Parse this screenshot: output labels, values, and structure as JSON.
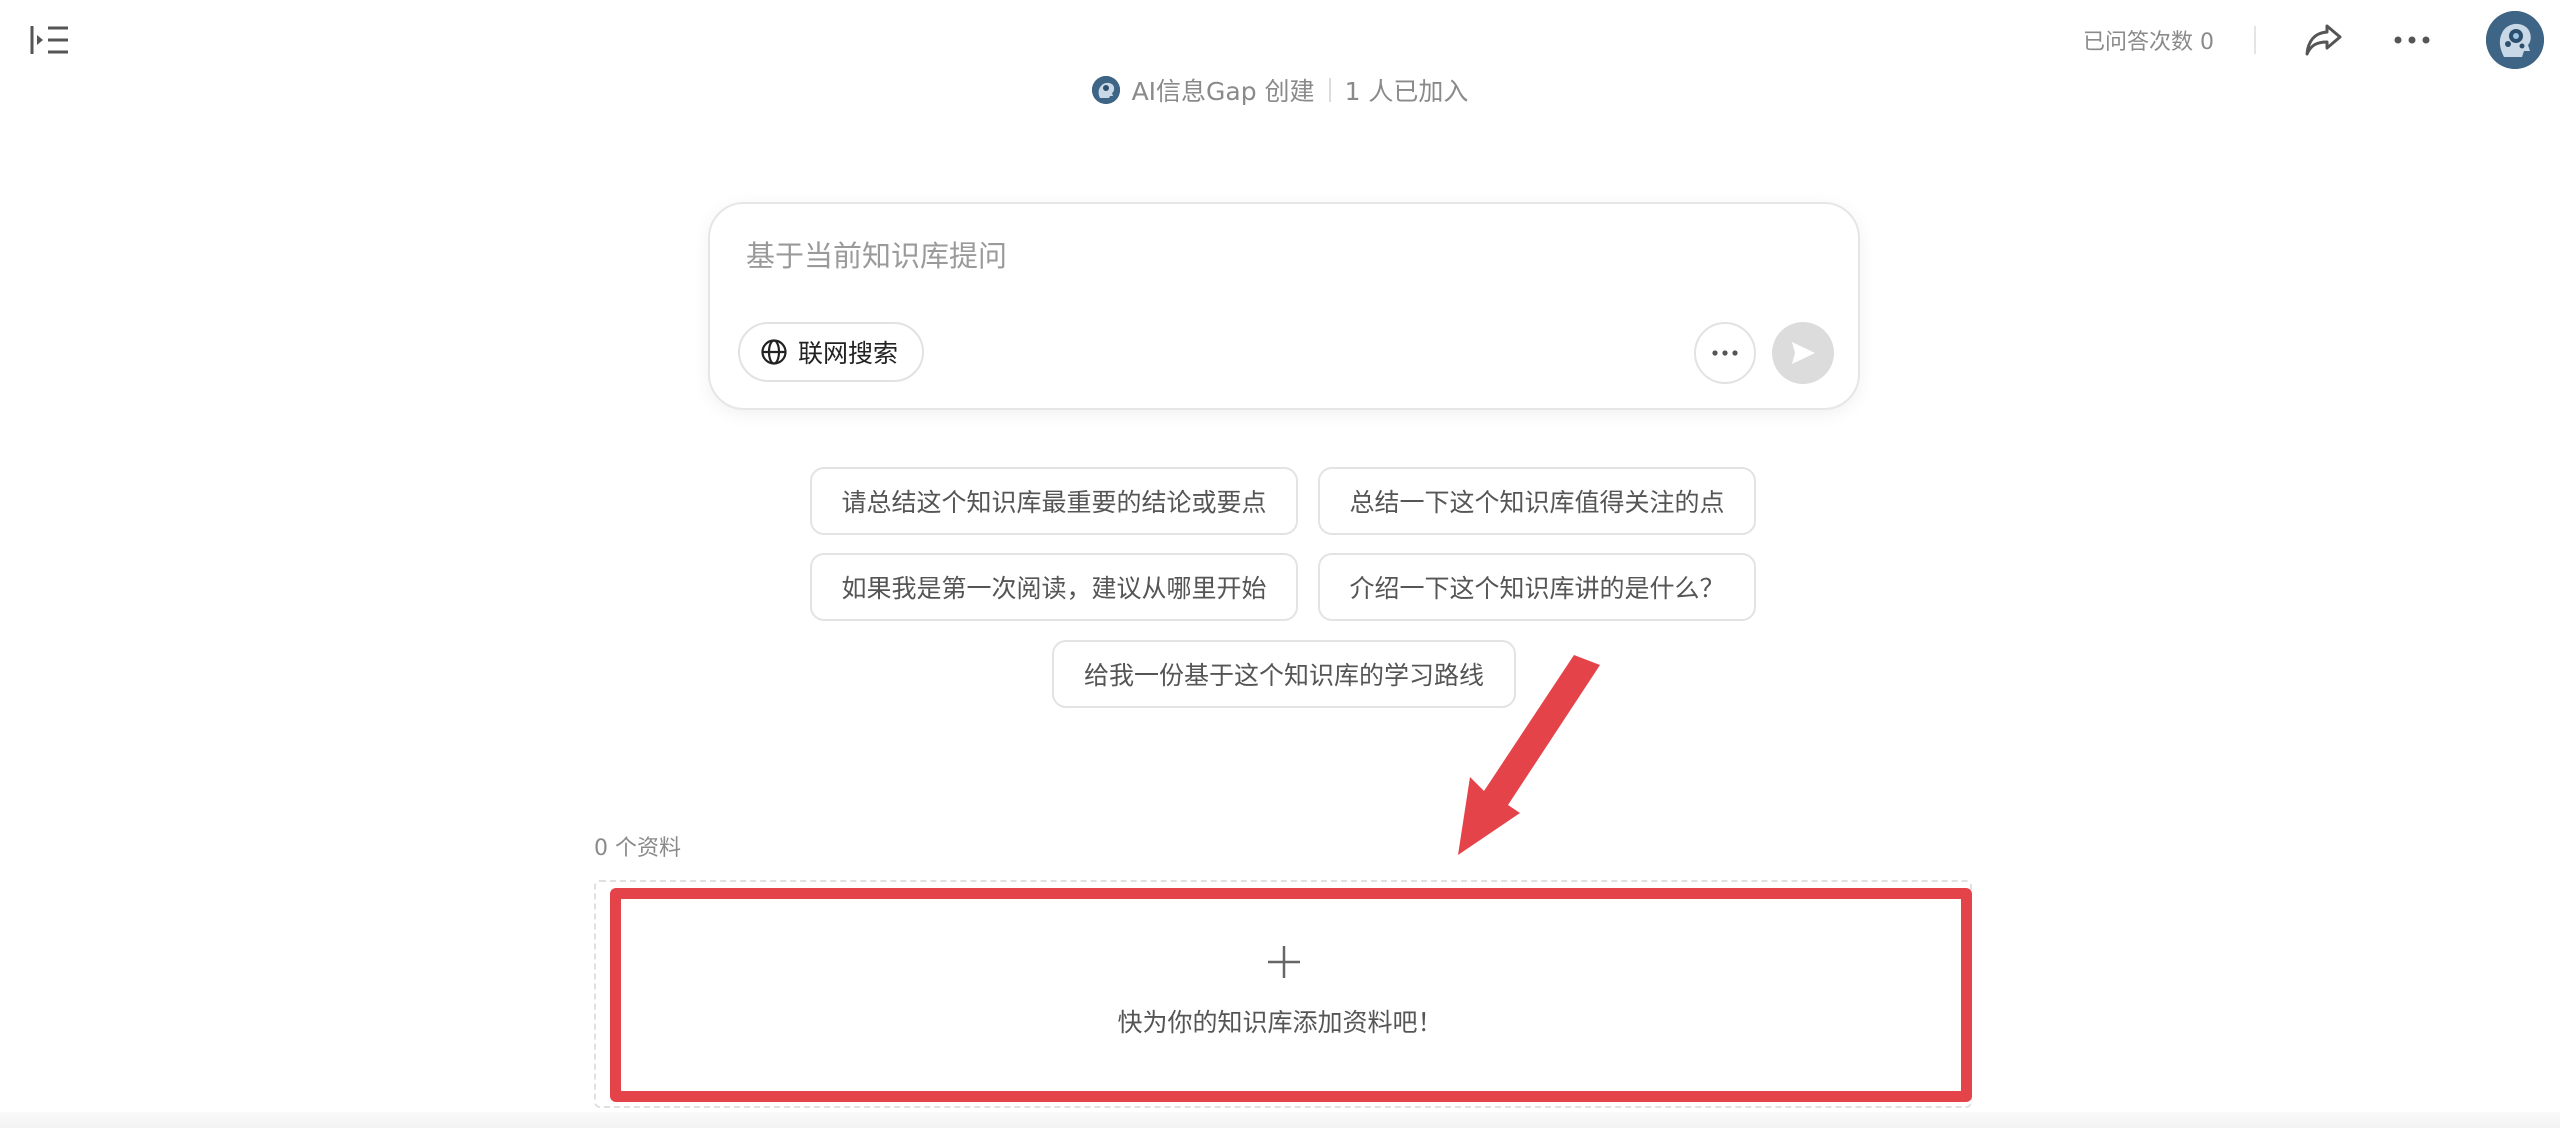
{
  "header": {
    "answer_count_label": "已问答次数 0"
  },
  "creator": {
    "name": "AI信息Gap 创建",
    "members": "1 人已加入"
  },
  "ask": {
    "placeholder": "基于当前知识库提问",
    "web_search_label": "联网搜索"
  },
  "suggestions": [
    {
      "label": "请总结这个知识库最重要的结论或要点"
    },
    {
      "label": "总结一下这个知识库值得关注的点"
    },
    {
      "label": "如果我是第一次阅读，建议从哪里开始"
    },
    {
      "label": "介绍一下这个知识库讲的是什么？"
    },
    {
      "label": "给我一份基于这个知识库的学习路线"
    }
  ],
  "materials": {
    "count_label": "0 个资料",
    "empty_add_label": "快为你的知识库添加资料吧！"
  },
  "colors": {
    "annotation_red": "#e5434a",
    "send_disabled": "#dcdcdc"
  },
  "icons": {
    "toggle": "sidebar-toggle-icon",
    "share": "share-icon",
    "more": "more-icon",
    "globe": "globe-icon",
    "send": "send-icon",
    "plus": "plus-icon"
  }
}
